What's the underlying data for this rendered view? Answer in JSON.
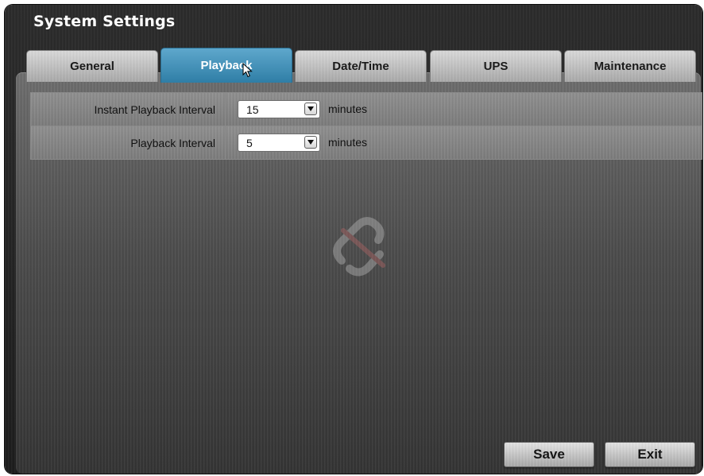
{
  "window": {
    "title": "System Settings"
  },
  "tabs": [
    {
      "label": "General",
      "active": false
    },
    {
      "label": "Playback",
      "active": true
    },
    {
      "label": "Date/Time",
      "active": false
    },
    {
      "label": "UPS",
      "active": false
    },
    {
      "label": "Maintenance",
      "active": false
    }
  ],
  "settings": [
    {
      "label": "Instant Playback Interval",
      "value": "15",
      "unit": "minutes"
    },
    {
      "label": "Playback Interval",
      "value": "5",
      "unit": "minutes"
    }
  ],
  "buttons": {
    "save": "Save",
    "exit": "Exit"
  },
  "icons": {
    "dropdown": "chevron-down-icon",
    "cursor": "mouse-pointer-icon",
    "watermark": "watermark-logo-icon"
  },
  "colors": {
    "active_tab": "#3b8ab3",
    "panel": "#5a5a5a",
    "window": "#262626"
  }
}
